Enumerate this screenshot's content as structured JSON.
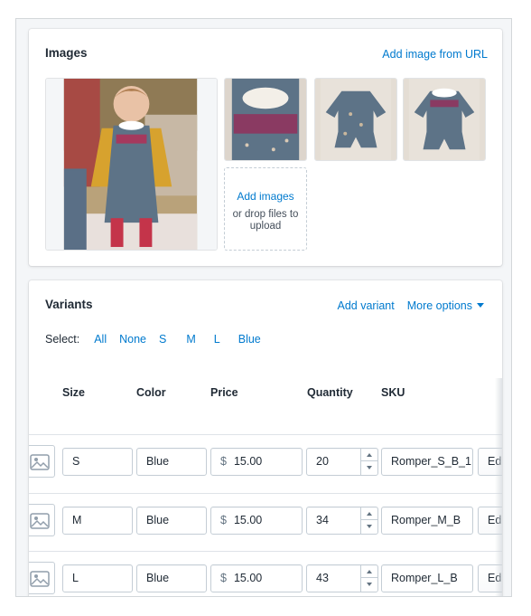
{
  "images_card": {
    "title": "Images",
    "add_from_url": "Add image from URL",
    "dropzone": {
      "action": "Add images",
      "hint": "or drop files to upload"
    }
  },
  "variants_card": {
    "title": "Variants",
    "add_variant": "Add variant",
    "more_options": "More options",
    "select": {
      "label": "Select:",
      "options": [
        "All",
        "None",
        "S",
        "M",
        "L",
        "Blue"
      ]
    },
    "columns": [
      "Size",
      "Color",
      "Price",
      "Quantity",
      "SKU"
    ],
    "currency_symbol": "$",
    "rows": [
      {
        "size": "S",
        "color": "Blue",
        "price": "15.00",
        "quantity": "20",
        "sku": "Romper_S_B_1",
        "edit": "Ed"
      },
      {
        "size": "M",
        "color": "Blue",
        "price": "15.00",
        "quantity": "34",
        "sku": "Romper_M_B",
        "edit": "Ed"
      },
      {
        "size": "L",
        "color": "Blue",
        "price": "15.00",
        "quantity": "43",
        "sku": "Romper_L_B",
        "edit": "Ed"
      }
    ]
  },
  "colors": {
    "link": "#007ace",
    "border": "#c4cdd5",
    "background": "#f4f6f8",
    "romper_blue": "#5d7387",
    "cardigan_yellow": "#d7a22e"
  },
  "icons": [
    "image-placeholder-icon",
    "caret-down-icon",
    "stepper-up-icon",
    "stepper-down-icon"
  ]
}
